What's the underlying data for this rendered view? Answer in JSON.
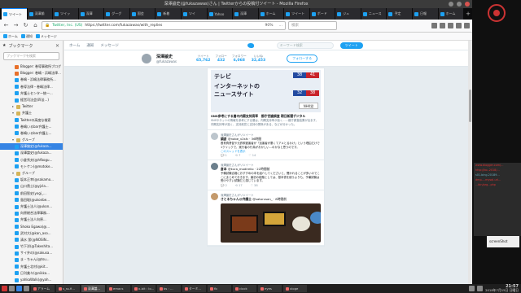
{
  "window": {
    "title": "深澤諭史(@fukazawas)さん | Twitterからの投稿付ツイート - Mozilla Firefox"
  },
  "tabs": [
    {
      "label": "ツイート"
    },
    {
      "label": "深澤諭"
    },
    {
      "label": "ツイッ"
    },
    {
      "label": "深澤"
    },
    {
      "label": "グーグ"
    },
    {
      "label": "国会"
    },
    {
      "label": "新着"
    },
    {
      "label": "ツイ"
    },
    {
      "label": "Yahoo"
    },
    {
      "label": "深澤"
    },
    {
      "label": "ホーム"
    },
    {
      "label": "ツイート"
    },
    {
      "label": "ボード"
    },
    {
      "label": "ジュ"
    },
    {
      "label": "ニュース"
    },
    {
      "label": "予定"
    },
    {
      "label": "日報"
    },
    {
      "label": "ホーム"
    }
  ],
  "urlbar": {
    "host": "Twitter, Inc. (US)",
    "url": "https://twitter.com/fukazawas/with_replies",
    "zoom": "90%",
    "more": "…"
  },
  "searchbar": {
    "placeholder": "検索"
  },
  "bookmarks": [
    {
      "label": "ホーム"
    },
    {
      "label": "通知"
    },
    {
      "label": "メッセージ"
    }
  ],
  "sidebar": {
    "title": "ブックマーク",
    "search_placeholder": "ブックマークを検索",
    "items": [
      {
        "label": "Blogger: 巻導事務所ブログ",
        "icon": "blogger"
      },
      {
        "label": "Blogger: 巻嶋・浜嶋法律...",
        "icon": "blogger"
      },
      {
        "label": "巻嶋・浜嶋法律事務所...",
        "icon": "twitter"
      },
      {
        "label": "巻導法律・巻嶋法律...",
        "icon": "twitter"
      },
      {
        "label": "弁護士センター統一...",
        "icon": "twitter"
      },
      {
        "label": "経営司法会(四法...)",
        "icon": "twitter"
      },
      {
        "label": "Twitter",
        "icon": "folder",
        "toggle": "▸"
      },
      {
        "label": "弁護士",
        "icon": "folder",
        "toggle": "▾"
      },
      {
        "label": "Twitterの高度な検索",
        "icon": "twitter"
      },
      {
        "label": "巻嶋いるbar弁護士...",
        "icon": "twitter"
      },
      {
        "label": "巻嶋いるbar弁護士...",
        "icon": "twitter"
      },
      {
        "label": "グループ",
        "icon": "folder",
        "toggle": "▾"
      },
      {
        "label": "深澤諭史(@fukaza...",
        "icon": "twitter",
        "selected": true
      },
      {
        "label": "深澤論史(@fukaza...",
        "icon": "twitter"
      },
      {
        "label": "小倉秀夫(@hfbogu...",
        "icon": "twitter"
      },
      {
        "label": "モトケン(@motoke...",
        "icon": "twitter"
      },
      {
        "label": "グループ",
        "icon": "folder",
        "toggle": "▾"
      },
      {
        "label": "坂本正幸(@sakamo...",
        "icon": "twitter"
      },
      {
        "label": "山口貴士(@yjcla...",
        "icon": "twitter"
      },
      {
        "label": "前田智史(yogi_...",
        "icon": "twitter"
      },
      {
        "label": "島田聡(@ukonbe...",
        "icon": "twitter"
      },
      {
        "label": "弁護士法人(@ukon...",
        "icon": "twitter"
      },
      {
        "label": "向原総合法律事務...",
        "icon": "twitter"
      },
      {
        "label": "弁護士法人向原...",
        "icon": "twitter"
      },
      {
        "label": "Shoko Egawa(@...",
        "icon": "twitter"
      },
      {
        "label": "武村大(@kan_aso...",
        "icon": "twitter"
      },
      {
        "label": "清水 潔(@NOSIN...",
        "icon": "twitter"
      },
      {
        "label": "竹下洋(@Takeshita...",
        "icon": "twitter"
      },
      {
        "label": "サイ弁の(@sakusa...",
        "icon": "twitter"
      },
      {
        "label": "ま・ちゃん(@tsu...",
        "icon": "twitter"
      },
      {
        "label": "弁護士北村(@kit...",
        "icon": "twitter"
      },
      {
        "label": "日刊美々(@nikka...",
        "icon": "twitter"
      },
      {
        "label": "yahkaWalk(@yah...",
        "icon": "twitter"
      },
      {
        "label": "幸村の井(@yukir...",
        "icon": "twitter"
      },
      {
        "label": "弁護士ちくすい(@...",
        "icon": "twitter"
      }
    ]
  },
  "twitter": {
    "nav": [
      {
        "label": "ホーム"
      },
      {
        "label": "通知"
      },
      {
        "label": "メッセージ"
      }
    ],
    "search_placeholder": "キーワード検索",
    "tweet_button": "ツイート",
    "profile": {
      "name": "深澤諭史",
      "handle": "@fukazawas",
      "stats": [
        {
          "label": "ツイート",
          "value": "65,762"
        },
        {
          "label": "フォロー",
          "value": "432"
        },
        {
          "label": "フォロワー",
          "value": "6,068"
        },
        {
          "label": "いいね",
          "value": "32,453"
        }
      ],
      "follow_button": "フォローする"
    },
    "card": {
      "rows": [
        {
          "label": "テレビ",
          "n1": "38",
          "n2": "41"
        },
        {
          "label": "インターネットの",
          "n1": "",
          "n2": ""
        },
        {
          "label": "ニュースサイト",
          "n1": "32",
          "n2": "38"
        }
      ],
      "nhk": "NHK党",
      "title": "SNS参考にする層の内閣支持高率　都庁世論調査 朝日新聞デジタル",
      "desc": "SNSやネットの情報を参考にする層は、内閣支持率が高く……都庁調査結果が出ます。内閣支持率が高く、支持政党と支持の関係がある、などが分かった。"
    },
    "tweets": [
      {
        "retweet": "深澤諭史さんがリツイート",
        "name": "鍋倉",
        "handle": "@nabe_v2sfc · 36時間",
        "text": "養育費督促や元詐欺被害者が「加害者が悪くてアメとるわけ」という理由だけで1クリックで、実行者の行為がおかしい…のかなと思うのです。",
        "link": "このスレッドを表示",
        "replies": "1",
        "retweets": "7",
        "likes": "14"
      },
      {
        "retweet": "深澤諭史さんがリツイート",
        "name": "倉本",
        "handle": "@kura_modirelio · 22時間前",
        "text": "予備試験合格におすすめの本を紹介してくださいと、聞かれることが多いのでここにまとめておきます。最初の段階としては、基本書を使うよりも、予備試験は受けやすい試験だと感じています。",
        "link": "",
        "replies": "2",
        "retweets": "17",
        "likes": "38"
      },
      {
        "retweet": "深澤諭史さんがリツイート",
        "name": "さとるちゃん@弁護士",
        "handle": "@satorusan_ · 8時間前",
        "text": "",
        "link": "",
        "replies": "",
        "retweets": "",
        "likes": ""
      }
    ]
  },
  "desktop": {
    "lines": [
      {
        "text": "www.blogger.com/...",
        "color": "red"
      },
      {
        "text": "http://bo..2018/...",
        "color": "red"
      },
      {
        "text": "s01.bing.20189...",
        "color": "blue"
      },
      {
        "text": "dmp-...mysql-url...",
        "color": "red"
      },
      {
        "text": "...bin/prg...php",
        "color": "red"
      }
    ],
    "popup": "screenShot"
  },
  "taskbar": {
    "tasks": [
      {
        "label": "アラーム"
      },
      {
        "label": "s_ss.fi..."
      },
      {
        "label": "深澤論..."
      },
      {
        "label": "emacs"
      },
      {
        "label": "x-bit : lo..."
      },
      {
        "label": "bs : ..."
      },
      {
        "label": "ターミ..."
      },
      {
        "label": "fb"
      },
      {
        "label": "clock"
      },
      {
        "label": "eyes"
      },
      {
        "label": "xloge"
      }
    ],
    "time": "21:57",
    "date": "2018年7月15日 日曜日"
  }
}
